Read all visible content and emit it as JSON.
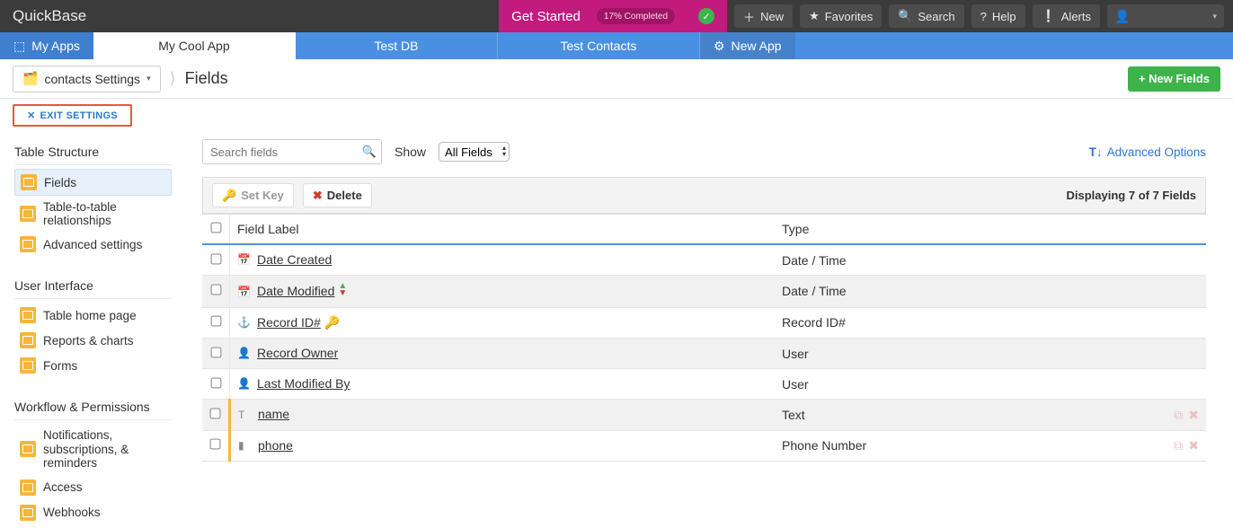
{
  "brand": "QuickBase",
  "getstarted": {
    "label": "Get Started",
    "progress": "17% Completed"
  },
  "topbtn": {
    "new": "New",
    "favorites": "Favorites",
    "search": "Search",
    "help": "Help",
    "alerts": "Alerts"
  },
  "tabs": {
    "myapps": "My Apps",
    "t1": "My Cool App",
    "t2": "Test DB",
    "t3": "Test Contacts",
    "newapp": "New App"
  },
  "settings": {
    "name": "contacts Settings",
    "exit": "EXIT SETTINGS"
  },
  "pageTitle": "Fields",
  "newFieldsBtn": "+ New Fields",
  "nav": {
    "h1": "Table Structure",
    "i1": "Fields",
    "i2": "Table-to-table relationships",
    "i3": "Advanced settings",
    "h2": "User Interface",
    "i4": "Table home page",
    "i5": "Reports & charts",
    "i6": "Forms",
    "h3": "Workflow & Permissions",
    "i7": "Notifications, subscriptions, & reminders",
    "i8": "Access",
    "i9": "Webhooks"
  },
  "toolbar": {
    "searchPlaceholder": "Search fields",
    "showLabel": "Show",
    "showValue": "All Fields",
    "advanced": "Advanced Options",
    "setkey": "Set Key",
    "delete": "Delete",
    "displaying": "Displaying 7 of 7 Fields"
  },
  "cols": {
    "label": "Field Label",
    "type": "Type"
  },
  "rows": [
    {
      "label": "Date Created",
      "type": "Date / Time",
      "icon": "📅"
    },
    {
      "label": "Date Modified",
      "type": "Date / Time",
      "icon": "📅",
      "sort": true
    },
    {
      "label": "Record ID#",
      "type": "Record ID#",
      "icon": "⚓",
      "key": true
    },
    {
      "label": "Record Owner",
      "type": "User",
      "icon": "👤"
    },
    {
      "label": "Last Modified By",
      "type": "User",
      "icon": "👤"
    },
    {
      "label": "name",
      "type": "Text",
      "icon": "T",
      "accent": true,
      "actions": true
    },
    {
      "label": "phone",
      "type": "Phone Number",
      "icon": "▮",
      "accent": true,
      "actions": true
    }
  ]
}
